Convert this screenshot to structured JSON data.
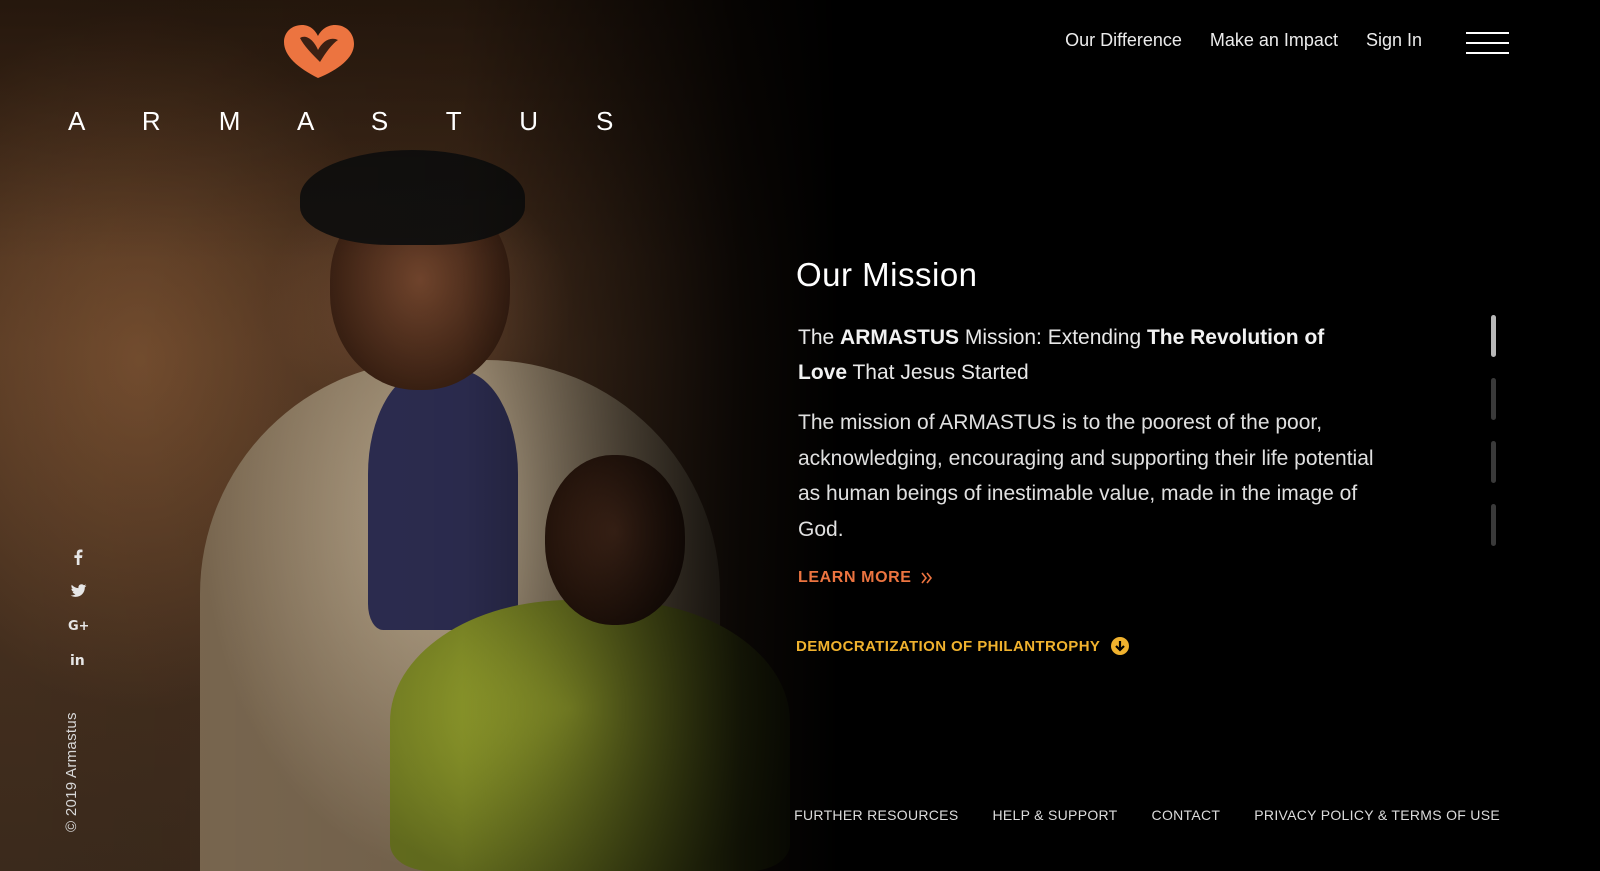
{
  "brand": {
    "name": "A R M A S T U S",
    "accent_color": "#ec7440"
  },
  "nav": {
    "links": [
      "Our Difference",
      "Make an Impact",
      "Sign In"
    ],
    "menu_icon": "hamburger-icon"
  },
  "mission": {
    "title": "Our Mission",
    "tagline_parts": {
      "p1": "The ",
      "b1": "ARMASTUS",
      "p2": " Mission: Extending ",
      "b2": "The Revolution of Love",
      "p3": " That Jesus Started"
    },
    "body": "The mission of ARMASTUS is to the poorest of the poor, acknowledging, encouraging and supporting their life potential as human beings of inestimable value, made in the image of God.",
    "learn_more": "LEARN MORE",
    "learn_more_icon": "double-chevron-right-icon"
  },
  "next_section": {
    "label": "DEMOCRATIZATION OF PHILANTROPHY",
    "icon": "arrow-down-circle-icon",
    "color": "#f0b22e"
  },
  "slider": {
    "count": 4,
    "active_index": 0
  },
  "social": {
    "icons": [
      "facebook-icon",
      "twitter-icon",
      "google-plus-icon",
      "linkedin-icon"
    ],
    "glyphs": [
      "f",
      "t",
      "G+",
      "in"
    ]
  },
  "copyright": "© 2019 Armastus",
  "footer": {
    "links": [
      "FURTHER RESOURCES",
      "HELP & SUPPORT",
      "CONTACT",
      "PRIVACY POLICY & TERMS OF USE"
    ]
  }
}
